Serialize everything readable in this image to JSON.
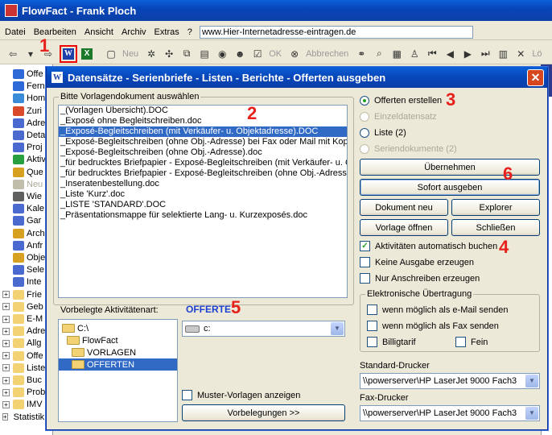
{
  "app": {
    "title": "FlowFact - Frank Ploch",
    "menu": [
      "Datei",
      "Bearbeiten",
      "Ansicht",
      "Archiv",
      "Extras",
      "?"
    ],
    "url_value": "www.Hier-Internetadresse-eintragen.de",
    "toolbar": {
      "neu": "Neu",
      "ok": "OK",
      "abbrechen": "Abbrechen",
      "lo": "Lö"
    }
  },
  "sidebar": {
    "items": [
      {
        "label": "Offe",
        "color": "#2d6ad8"
      },
      {
        "label": "Fern",
        "color": "#2d6ad8"
      },
      {
        "label": "Hom",
        "color": "#3a8bd8"
      },
      {
        "label": "Zuri",
        "color": "#d84a2a"
      },
      {
        "label": "Adre",
        "color": "#4a6ad0"
      },
      {
        "label": "Deta",
        "color": "#4a6ad0"
      },
      {
        "label": "Proj",
        "color": "#4a6ad0"
      },
      {
        "label": "Aktiv",
        "color": "#28a040"
      },
      {
        "label": "Que",
        "color": "#d8a020"
      },
      {
        "label": "Neu",
        "color": "#c0bdaa"
      },
      {
        "label": "Wie",
        "color": "#606060"
      },
      {
        "label": "Kale",
        "color": "#4a6ad0"
      },
      {
        "label": "Gar",
        "color": "#4a6ad0"
      },
      {
        "label": "Arch",
        "color": "#d8a020"
      },
      {
        "label": "Anfr",
        "color": "#4a6ad0"
      },
      {
        "label": "Obje",
        "color": "#d8a020"
      },
      {
        "label": "Sele",
        "color": "#4a6ad0"
      },
      {
        "label": "Inte",
        "color": "#4a6ad0"
      },
      {
        "label": "Frie",
        "color": "#f3d274"
      },
      {
        "label": "Geb",
        "color": "#f3d274"
      },
      {
        "label": "E-M",
        "color": "#f3d274"
      },
      {
        "label": "Adre",
        "color": "#f3d274"
      },
      {
        "label": "Allg",
        "color": "#f3d274"
      },
      {
        "label": "Offe",
        "color": "#f3d274"
      },
      {
        "label": "Liste",
        "color": "#f3d274"
      },
      {
        "label": "Buc",
        "color": "#f3d274"
      },
      {
        "label": "Prob",
        "color": "#f3d274"
      },
      {
        "label": "IMV",
        "color": "#f3d274"
      },
      {
        "label": "Statistik für Success",
        "color": "#f3d274"
      }
    ]
  },
  "dialog": {
    "title": "Datensätze - Serienbriefe - Listen - Berichte - Offerten ausgeben",
    "template_group_label": "Bitte Vorlagendokument auswählen",
    "templates": [
      "_(Vorlagen Übersicht).DOC",
      "_Exposé ohne Begleitschreiben.doc",
      "_Exposé-Begleitschreiben (mit Verkäufer- u. Objektadresse).DOC",
      "_Exposé-Begleitschreiben (ohne Obj.-Adresse) bei Fax oder Mail mit Kopf.doc",
      "_Exposé-Begleitschreiben (ohne Obj.-Adresse).doc",
      "_für bedrucktes Briefpapier - Exposé-Begleitschreiben (mit Verkäufer- u. Obj",
      "_für bedrucktes Briefpapier - Exposé-Begleitschreiben (ohne Obj.-Adresse).doc",
      "_Inseratenbestellung.doc",
      "_Liste 'Kurz'.doc",
      "_LISTE 'STANDARD'.DOC",
      "_Präsentationsmappe für selektierte Lang- u. Kurzexposés.doc"
    ],
    "selected_template_index": 2,
    "activity_label": "Vorbelegte Aktivitätenart:",
    "activity_value": "OFFERTE",
    "tree": [
      "C:\\",
      "FlowFact",
      "VORLAGEN",
      "OFFERTEN"
    ],
    "drive": "c:",
    "show_templates_label": "Muster-Vorlagen anzeigen",
    "preset_button": "Vorbelegungen >>",
    "radios": [
      {
        "label": "Offerten erstellen",
        "checked": true,
        "disabled": false
      },
      {
        "label": "Einzeldatensatz",
        "checked": false,
        "disabled": true
      },
      {
        "label": "Liste (2)",
        "checked": false,
        "disabled": false
      },
      {
        "label": "Seriendokumente (2)",
        "checked": false,
        "disabled": true
      }
    ],
    "buttons": {
      "uebernehmen": "Übernehmen",
      "sofort": "Sofort ausgeben",
      "neu": "Dokument neu",
      "explorer": "Explorer",
      "oeffnen": "Vorlage öffnen",
      "schliessen": "Schließen"
    },
    "checks": [
      {
        "label": "Aktivitäten automatisch buchen",
        "checked": true
      },
      {
        "label": "Keine Ausgabe erzeugen",
        "checked": false
      },
      {
        "label": "Nur Anschreiben erzeugen",
        "checked": false
      }
    ],
    "elec_group_label": "Elektronische Übertragung",
    "elec_checks": {
      "email": "wenn möglich als e-Mail senden",
      "fax": "wenn möglich als Fax senden",
      "billig": "Billigtarif",
      "fein": "Fein"
    },
    "std_printer_label": "Standard-Drucker",
    "std_printer": "\\\\powerserver\\HP LaserJet 9000 Fach3",
    "fax_printer_label": "Fax-Drucker",
    "fax_printer": "\\\\powerserver\\HP LaserJet 9000 Fach3"
  },
  "annotations": {
    "a1": "1",
    "a2": "2",
    "a3": "3",
    "a4": "4",
    "a5": "5",
    "a6": "6"
  },
  "colors": {
    "accent": "#316ac5",
    "annotation": "#e8201b",
    "titlebar": "#0846b8"
  }
}
